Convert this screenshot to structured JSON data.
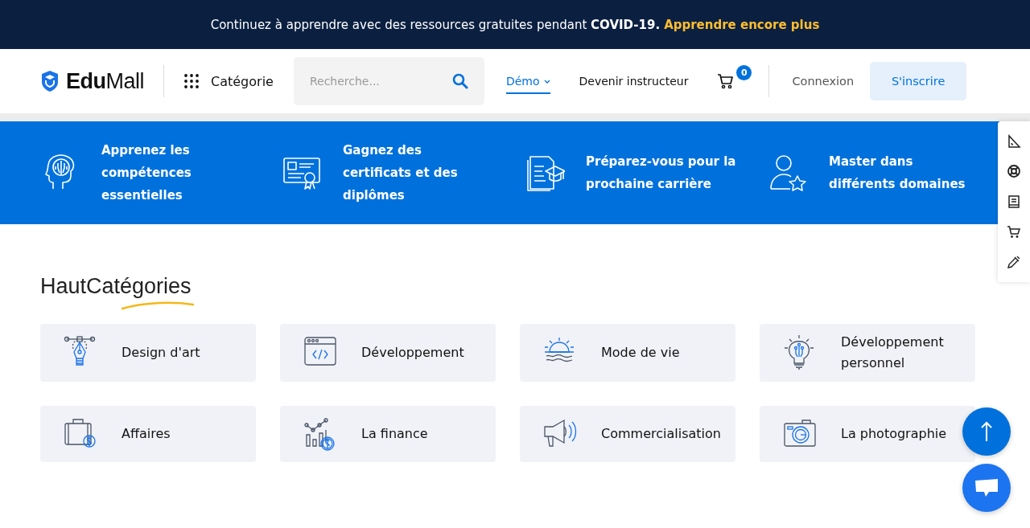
{
  "announcement": {
    "text": "Continuez à apprendre avec des ressources gratuites pendant **COVID-19.**",
    "link": "Apprendre encore plus"
  },
  "header": {
    "logo": {
      "part1": "Edu",
      "part2": "Mall"
    },
    "category_label": "Catégorie",
    "search": {
      "placeholder": "Recherche..."
    },
    "nav": [
      {
        "label": "Démo",
        "selected": true,
        "dropdown": true
      },
      {
        "label": "Devenir instructeur",
        "selected": false,
        "dropdown": false
      }
    ],
    "cart_count": "0",
    "login": "Connexion",
    "signup": "S'inscrire"
  },
  "features": [
    {
      "text": "Apprenez les compétences essentielles"
    },
    {
      "text": "Gagnez des certificats et des diplômes"
    },
    {
      "text": "Préparez-vous pour la prochaine carrière"
    },
    {
      "text": "Master dans différents domaines"
    }
  ],
  "categories_section": {
    "title_part1": "Haut",
    "title_part2": "Catégories",
    "items": [
      {
        "label": "Design d'art"
      },
      {
        "label": "Développement"
      },
      {
        "label": "Mode de vie"
      },
      {
        "label": "Développement personnel"
      },
      {
        "label": "Affaires"
      },
      {
        "label": "La finance"
      },
      {
        "label": "Commercialisation"
      },
      {
        "label": "La photographie"
      }
    ]
  }
}
